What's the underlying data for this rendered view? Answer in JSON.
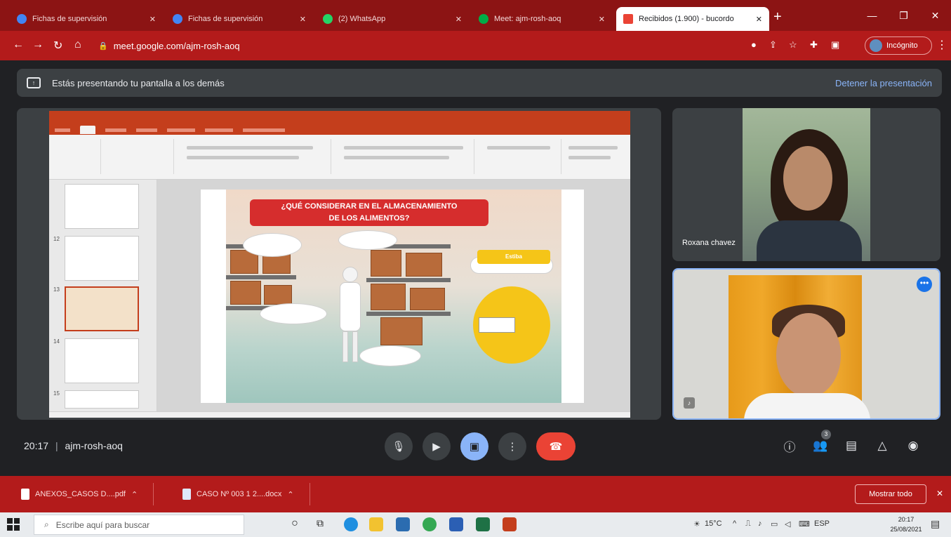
{
  "browser": {
    "tabs": [
      {
        "title": "Fichas de supervisión",
        "favicon_color": "#4285f4",
        "active": false
      },
      {
        "title": "Fichas de supervisión",
        "favicon_color": "#4285f4",
        "active": false
      },
      {
        "title": "(2) WhatsApp",
        "favicon_color": "#25d366",
        "active": false
      },
      {
        "title": "Meet: ajm-rosh-aoq",
        "favicon_color": "#00ac47",
        "active": false
      },
      {
        "title": "Recibidos (1.900) - bucordo",
        "favicon_color": "#ea4335",
        "active": true
      }
    ],
    "new_tab": "+",
    "url": "meet.google.com/ajm-rosh-aoq",
    "profile_label": "Incógnito",
    "window_controls": [
      "—",
      "❐",
      "✕"
    ]
  },
  "meet": {
    "banner_text": "Estás presentando tu pantalla a los demás",
    "stop_label": "Detener la presentación",
    "time": "20:17",
    "meeting_code": "ajm-rosh-aoq",
    "participants_count": "3",
    "participants": [
      {
        "name": "Roxana chavez"
      },
      {
        "name": ""
      }
    ]
  },
  "slide": {
    "heading_line1": "¿QUÉ CONSIDERAR EN EL ALMACENAMIENTO",
    "heading_line2": "DE LOS ALIMENTOS?",
    "yellow_label": "Estiba",
    "thumb_numbers": [
      "",
      "12",
      "13",
      "14",
      "15"
    ]
  },
  "downloads": {
    "items": [
      {
        "name": "ANEXOS_CASOS D....pdf",
        "arrow": "⌃"
      },
      {
        "name": "CASO Nº 003 1 2....docx",
        "arrow": "⌃"
      }
    ],
    "show_all": "Mostrar todo",
    "close": "✕"
  },
  "taskbar": {
    "search_placeholder": "Escribe aquí para buscar",
    "weather": "15°C",
    "time": "20:17",
    "date": "25/08/2021"
  },
  "colors": {
    "chrome_frame": "#8c1414",
    "toolbar": "#b31b1b",
    "meet_bg": "#202124",
    "end_call": "#ea4335",
    "accent_blue": "#8ab4f8"
  }
}
